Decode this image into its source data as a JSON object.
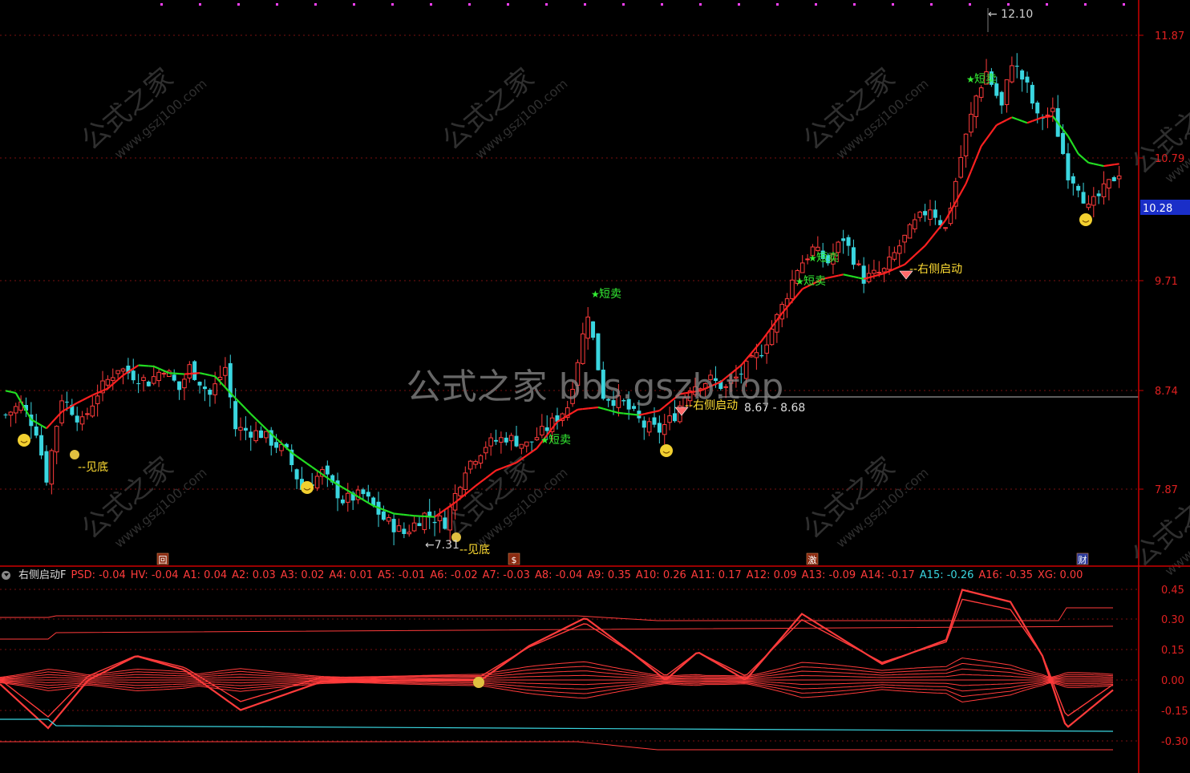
{
  "colors": {
    "up": "#ff3b3b",
    "down": "#3ad6e0",
    "ma_up": "#ff2020",
    "ma_down": "#22dd22",
    "grid": "#7a1010",
    "axis": "#cc0000",
    "buy_label": "#ffdd33",
    "sell_label": "#33ee33",
    "watermark": "#555555"
  },
  "price_axis": {
    "ticks": [
      "11.87",
      "10.79",
      "9.71",
      "8.74",
      "7.87"
    ],
    "current_price": "10.28"
  },
  "indicator_axis": {
    "ticks": [
      "0.45",
      "0.30",
      "0.15",
      "0.00",
      "-0.15",
      "-0.30"
    ]
  },
  "annotations": {
    "high_label": "12.10",
    "low_label": "7.31",
    "range_label": "8.67 - 8.68",
    "bottom": "见底",
    "short_sell": "短卖",
    "right_start": "右侧启动"
  },
  "date_markers": [
    "回",
    "$",
    "激",
    "财"
  ],
  "watermarks": {
    "center": "公式之家 bbs.gszb.top",
    "tile_cn": "公式之家",
    "tile_url": "www.gszj100.com"
  },
  "indicator": {
    "title": "右侧启动F",
    "items": [
      {
        "label": "PSD: -0.04",
        "color": "red"
      },
      {
        "label": "HV: -0.04",
        "color": "red"
      },
      {
        "label": "A1: 0.04",
        "color": "red"
      },
      {
        "label": "A2: 0.03",
        "color": "red"
      },
      {
        "label": "A3: 0.02",
        "color": "red"
      },
      {
        "label": "A4: 0.01",
        "color": "red"
      },
      {
        "label": "A5: -0.01",
        "color": "red"
      },
      {
        "label": "A6: -0.02",
        "color": "red"
      },
      {
        "label": "A7: -0.03",
        "color": "red"
      },
      {
        "label": "A8: -0.04",
        "color": "red"
      },
      {
        "label": "A9: 0.35",
        "color": "red"
      },
      {
        "label": "A10: 0.26",
        "color": "red"
      },
      {
        "label": "A11: 0.17",
        "color": "red"
      },
      {
        "label": "A12: 0.09",
        "color": "red"
      },
      {
        "label": "A13: -0.09",
        "color": "red"
      },
      {
        "label": "A14: -0.17",
        "color": "red"
      },
      {
        "label": "A15: -0.26",
        "color": "cyan"
      },
      {
        "label": "A16: -0.35",
        "color": "red"
      },
      {
        "label": "XG: 0.00",
        "color": "red"
      }
    ]
  },
  "chart_data": {
    "type": "candlestick",
    "y_range": [
      7.17,
      12.27
    ],
    "ma_anchors": [
      [
        0,
        8.74
      ],
      [
        2,
        8.72
      ],
      [
        5,
        8.48
      ],
      [
        8,
        8.4
      ],
      [
        11,
        8.55
      ],
      [
        14,
        8.63
      ],
      [
        17,
        8.7
      ],
      [
        20,
        8.76
      ],
      [
        23,
        8.88
      ],
      [
        26,
        8.97
      ],
      [
        29,
        8.96
      ],
      [
        32,
        8.9
      ],
      [
        35,
        8.89
      ],
      [
        38,
        8.9
      ],
      [
        41,
        8.87
      ],
      [
        44,
        8.72
      ],
      [
        48,
        8.53
      ],
      [
        52,
        8.35
      ],
      [
        56,
        8.18
      ],
      [
        60,
        8.05
      ],
      [
        64,
        7.92
      ],
      [
        68,
        7.81
      ],
      [
        72,
        7.7
      ],
      [
        76,
        7.63
      ],
      [
        80,
        7.61
      ],
      [
        84,
        7.6
      ],
      [
        88,
        7.73
      ],
      [
        92,
        7.88
      ],
      [
        96,
        8.02
      ],
      [
        100,
        8.09
      ],
      [
        104,
        8.22
      ],
      [
        108,
        8.46
      ],
      [
        112,
        8.57
      ],
      [
        116,
        8.59
      ],
      [
        120,
        8.54
      ],
      [
        124,
        8.52
      ],
      [
        128,
        8.56
      ],
      [
        132,
        8.71
      ],
      [
        136,
        8.74
      ],
      [
        140,
        8.82
      ],
      [
        144,
        8.97
      ],
      [
        148,
        9.19
      ],
      [
        152,
        9.44
      ],
      [
        156,
        9.66
      ],
      [
        160,
        9.75
      ],
      [
        164,
        9.79
      ],
      [
        168,
        9.75
      ],
      [
        172,
        9.8
      ],
      [
        176,
        9.88
      ],
      [
        180,
        10.05
      ],
      [
        184,
        10.28
      ],
      [
        188,
        10.61
      ],
      [
        191,
        10.95
      ],
      [
        194,
        11.14
      ],
      [
        197,
        11.21
      ],
      [
        200,
        11.16
      ],
      [
        203,
        11.21
      ],
      [
        205,
        11.22
      ],
      [
        208,
        11.04
      ],
      [
        210,
        10.88
      ],
      [
        212,
        10.8
      ],
      [
        215,
        10.77
      ],
      [
        218,
        10.79
      ]
    ],
    "pivots": [
      [
        0,
        8.52
      ],
      [
        3,
        8.62
      ],
      [
        6,
        8.38
      ],
      [
        8,
        7.95
      ],
      [
        11,
        8.68
      ],
      [
        15,
        8.45
      ],
      [
        18,
        8.72
      ],
      [
        22,
        8.95
      ],
      [
        25,
        8.88
      ],
      [
        28,
        8.82
      ],
      [
        31,
        8.95
      ],
      [
        34,
        8.75
      ],
      [
        36,
        8.95
      ],
      [
        40,
        8.7
      ],
      [
        43,
        8.95
      ],
      [
        45,
        8.4
      ],
      [
        50,
        8.35
      ],
      [
        55,
        8.18
      ],
      [
        58,
        7.85
      ],
      [
        62,
        8.0
      ],
      [
        66,
        7.75
      ],
      [
        70,
        7.8
      ],
      [
        74,
        7.58
      ],
      [
        78,
        7.45
      ],
      [
        82,
        7.62
      ],
      [
        86,
        7.55
      ],
      [
        90,
        8.05
      ],
      [
        94,
        8.25
      ],
      [
        98,
        8.32
      ],
      [
        102,
        8.25
      ],
      [
        106,
        8.4
      ],
      [
        110,
        8.6
      ],
      [
        114,
        9.45
      ],
      [
        117,
        8.7
      ],
      [
        121,
        8.62
      ],
      [
        125,
        8.42
      ],
      [
        128,
        8.38
      ],
      [
        131,
        8.52
      ],
      [
        134,
        8.78
      ],
      [
        138,
        8.84
      ],
      [
        141,
        8.76
      ],
      [
        145,
        8.95
      ],
      [
        148,
        9.1
      ],
      [
        152,
        9.5
      ],
      [
        155,
        9.85
      ],
      [
        158,
        10.02
      ],
      [
        161,
        9.9
      ],
      [
        164,
        10.12
      ],
      [
        168,
        9.75
      ],
      [
        172,
        9.82
      ],
      [
        175,
        10.05
      ],
      [
        178,
        10.25
      ],
      [
        181,
        10.4
      ],
      [
        184,
        10.2
      ],
      [
        187,
        10.85
      ],
      [
        190,
        11.4
      ],
      [
        192,
        11.62
      ],
      [
        195,
        11.3
      ],
      [
        197,
        11.72
      ],
      [
        200,
        11.48
      ],
      [
        202,
        11.2
      ],
      [
        205,
        11.25
      ],
      [
        208,
        10.7
      ],
      [
        210,
        10.6
      ],
      [
        212,
        10.38
      ],
      [
        215,
        10.55
      ],
      [
        218,
        10.72
      ]
    ],
    "markers": [
      {
        "x": 93,
        "price": "low",
        "type": "bottom"
      },
      {
        "x": 569,
        "price": 7.45,
        "type": "bottom"
      },
      {
        "x": 741,
        "price": 9.58,
        "type": "short_sell"
      },
      {
        "x": 678,
        "price": 8.34,
        "type": "short_sell"
      },
      {
        "x": 996,
        "price": 9.71,
        "type": "short_sell"
      },
      {
        "x": 1012,
        "price": 9.9,
        "type": "short_sell"
      },
      {
        "x": 1209,
        "price": 11.45,
        "type": "short_sell"
      },
      {
        "x": 850,
        "price": 8.62,
        "type": "right_start"
      },
      {
        "x": 1130,
        "price": 9.75,
        "type": "right_start"
      }
    ],
    "smileys": [
      [
        30,
        8.44
      ],
      [
        383,
        7.93
      ],
      [
        831,
        8.33
      ],
      [
        1354,
        10.18
      ]
    ],
    "x_count": 219
  }
}
